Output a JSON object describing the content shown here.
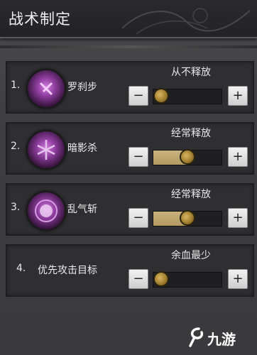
{
  "header": {
    "title": "战术制定"
  },
  "rows": [
    {
      "num": "1.",
      "name": "罗刹步",
      "option": "从不释放",
      "level": 0.0,
      "icon": "skill-rakshasa-step-icon",
      "has_icon": true
    },
    {
      "num": "2.",
      "name": "暗影杀",
      "option": "经常释放",
      "level": 0.5,
      "icon": "skill-shadow-kill-icon",
      "has_icon": true
    },
    {
      "num": "3.",
      "name": "乱气斩",
      "option": "经常释放",
      "level": 0.5,
      "icon": "skill-chaos-slash-icon",
      "has_icon": true
    },
    {
      "num": "4.",
      "name": "优先攻击目标",
      "option": "余血最少",
      "level": 0.0,
      "icon": "",
      "has_icon": false
    }
  ],
  "buttons": {
    "minus": "−",
    "plus": "+"
  },
  "watermark": {
    "text": "九游"
  },
  "colors": {
    "fill": "#c9b27e",
    "knob": "#b08a35",
    "accent": "#8a3b9a"
  }
}
